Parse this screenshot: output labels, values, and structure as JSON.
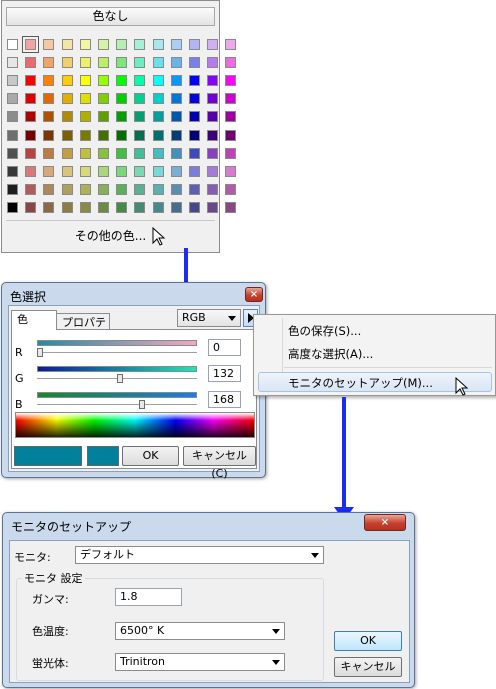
{
  "palette": {
    "no_color": "色なし",
    "more_colors": "その他の色...",
    "rows": [
      [
        "#ffffff",
        "#f2a3a3",
        "#f6c8a0",
        "#f4e5a6",
        "#f2f5a4",
        "#d6f4a6",
        "#b4f0b4",
        "#a6f0d8",
        "#a6e8f2",
        "#a8cff4",
        "#b2b4f4",
        "#d0b0f2",
        "#f0a8ec"
      ],
      [
        "#e6e6e6",
        "#ee6a6a",
        "#f0a46a",
        "#efd06a",
        "#eef06a",
        "#bdee6a",
        "#7ae87a",
        "#6aeec4",
        "#6ae0ee",
        "#6ab2ee",
        "#7a7eee",
        "#b47aee",
        "#ee6ae2"
      ],
      [
        "#c8c8c8",
        "#ff0000",
        "#ff8000",
        "#ffcc00",
        "#ffff00",
        "#99ff00",
        "#00ff00",
        "#00ffaa",
        "#00ffff",
        "#0099ff",
        "#0000ff",
        "#8800ff",
        "#ff00ff"
      ],
      [
        "#a9a9a9",
        "#e00000",
        "#e06a00",
        "#e0b000",
        "#e0e000",
        "#80d000",
        "#00d000",
        "#00d090",
        "#00d0d0",
        "#0078d8",
        "#0000d8",
        "#7000d8",
        "#d000d0"
      ],
      [
        "#8c8c8c",
        "#b00000",
        "#b05000",
        "#b08a00",
        "#b0b000",
        "#60a000",
        "#00a000",
        "#00a070",
        "#00a0a0",
        "#0058b0",
        "#0000b0",
        "#5800b0",
        "#a000a0"
      ],
      [
        "#6e6e6e",
        "#7a0000",
        "#7a3800",
        "#7a6000",
        "#7a7a00",
        "#447000",
        "#007000",
        "#00704e",
        "#007070",
        "#003e7a",
        "#00007a",
        "#3e007a",
        "#700070"
      ],
      [
        "#505050",
        "#c04040",
        "#c07a40",
        "#c0a040",
        "#c0c040",
        "#8ac040",
        "#40c040",
        "#40c09a",
        "#40c0c0",
        "#4090c0",
        "#4048c0",
        "#8840c0",
        "#c040b8"
      ],
      [
        "#383838",
        "#d87a7a",
        "#d8a87a",
        "#d8c47a",
        "#d8d87a",
        "#a8d87a",
        "#7ad87a",
        "#7ad8b4",
        "#7ad8d8",
        "#7aaed8",
        "#7a7ed8",
        "#a87ad8",
        "#d87ad0"
      ],
      [
        "#1e1e1e",
        "#b05c5c",
        "#b0875c",
        "#b0a05c",
        "#b0b05c",
        "#88b05c",
        "#5cb05c",
        "#5cb092",
        "#5cb0b0",
        "#5c8cb0",
        "#5c60b0",
        "#885cb0",
        "#b05caa"
      ],
      [
        "#000000",
        "#8a4646",
        "#8a6a46",
        "#8a7e46",
        "#8a8a46",
        "#6a8a46",
        "#468a46",
        "#468a72",
        "#468a8a",
        "#466e8a",
        "#46488a",
        "#6a468a",
        "#8a4686"
      ]
    ]
  },
  "color_dialog": {
    "title": "色選択",
    "close": "×",
    "tabs": [
      "色",
      "プロパティ"
    ],
    "mode": "RGB",
    "channels": [
      {
        "label": "R",
        "value": "0",
        "level": 0.0,
        "from": "#1f8da8",
        "to": "#f4a7c0"
      },
      {
        "label": "G",
        "value": "132",
        "level": 0.52,
        "from": "#0a1a9c",
        "to": "#1ee6b4"
      },
      {
        "label": "B",
        "value": "168",
        "level": 0.66,
        "from": "#148a2a",
        "to": "#1c7ce8"
      }
    ],
    "current_color": "#00809a",
    "ok": "OK",
    "cancel": "キャンセル(C)"
  },
  "menu": {
    "items": [
      "色の保存(S)...",
      "高度な選択(A)...",
      "モニタのセットアップ(M)..."
    ]
  },
  "monitor_dialog": {
    "title": "モニタのセットアップ",
    "close": "×",
    "monitor_label": "モニタ:",
    "monitor_value": "デフォルト",
    "group_label": "モニタ 設定",
    "gamma_label": "ガンマ:",
    "gamma_value": "1.8",
    "temp_label": "色温度:",
    "temp_value": "6500° K",
    "phosphor_label": "蛍光体:",
    "phosphor_value": "Trinitron",
    "ok": "OK",
    "cancel": "キャンセル"
  },
  "colors": {
    "arrow": "#1c2cf0",
    "window_frame": "#cad9ec"
  }
}
